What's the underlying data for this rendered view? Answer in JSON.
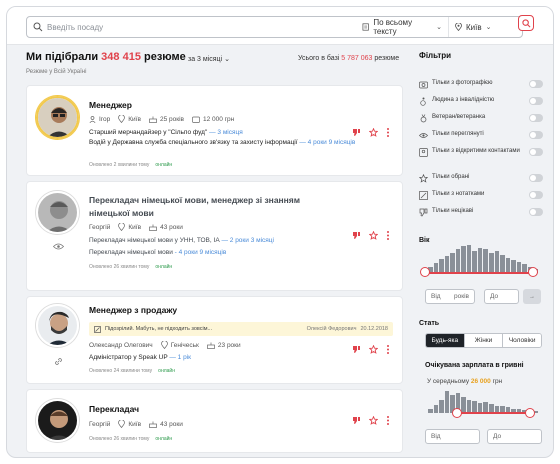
{
  "search": {
    "placeholder": "Введіть посаду",
    "scope": "По всьому тексту",
    "city": "Київ"
  },
  "header": {
    "title_pre": "Ми підібрали ",
    "count": "348 415",
    "title_post": " резюме",
    "subtitle": "Резюме у Всій Україні",
    "period": "за 3 місяці",
    "total_pre": "Усього в базі ",
    "total": "5 787 063",
    "total_post": " резюме"
  },
  "cards": [
    {
      "title": "Менеджер",
      "name": "Ігор",
      "city": "Київ",
      "age": "25 років",
      "salary": "12 000 грн",
      "line1": "Старший мерчандайзер у \"Сільпо фуд\"",
      "line1b": " — 3 місяця",
      "line2": "Водій у Державна служба спеціального зв'язку та захисту інформації",
      "line2b": " — 4 роки 9 місяців",
      "updated": "Оновлено 2 хвилини тому",
      "online": "онлайн"
    },
    {
      "title": "Перекладач німецької мови, менеджер зі знанням німецької мови",
      "name": "Георгій",
      "city": "Київ",
      "age": "43 роки",
      "line1": "Перекладач німецької мови у УНН, ТОВ, ІА",
      "line1b": " — 2 роки 3 місяці",
      "line2": "Перекладач німецької мови",
      "line2b": " - 4 роки 9 місяців",
      "updated": "Оновлено 26 хвилин тому",
      "online": "онлайн"
    },
    {
      "title": "Менеджер з продажу",
      "note": "Підозрілий. Мабуть, не підходить зовсім...",
      "note_by": "Олексій Федорович",
      "note_date": "20.12.2018",
      "name": "Олександр Олегович",
      "city": "Генічеськ",
      "age": "23 роки",
      "line1": "Адміністратор у Speak UP",
      "line1b": " — 1 рік",
      "updated": "Оновлено 24 хвилини тому",
      "online": "онлайн"
    },
    {
      "title": "Перекладач",
      "name": "Георгій",
      "city": "Київ",
      "age": "43 роки",
      "updated": "Оновлено 26 хвилин тому",
      "online": "онлайн"
    }
  ],
  "filters": {
    "title": "Фільтри",
    "items": [
      "Тільки з фотографією",
      "Людина з інвалідністю",
      "Ветеран/ветеранка",
      "Тільки переглянуті",
      "Тільки з відкритими контактами",
      "Тільки обрані",
      "Тільки з нотатками",
      "Тільки нецікаві"
    ]
  },
  "age": {
    "title": "Вік",
    "from": "Від",
    "to": "До",
    "unit": "років"
  },
  "gender": {
    "title": "Стать",
    "options": [
      "Будь-яка",
      "Жінки",
      "Чоловіки"
    ]
  },
  "salary": {
    "title": "Очікувана зарплата в гривні",
    "avg_pre": "У середньому ",
    "avg": "26 000",
    "avg_post": " грн",
    "from": "Від",
    "to": "До"
  },
  "colors": {
    "accent": "#e0424b",
    "dark": "#1f2328",
    "orange": "#e8a11d"
  }
}
